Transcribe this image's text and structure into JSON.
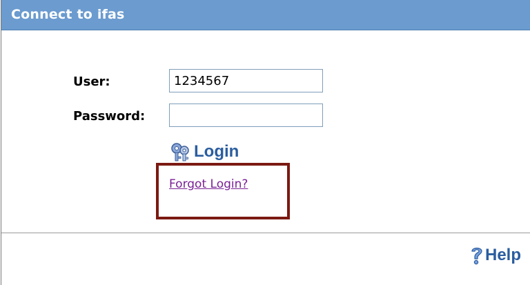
{
  "dialog": {
    "title": "Connect to ifas"
  },
  "form": {
    "user_label": "User:",
    "user_value": "1234567",
    "password_label": "Password:",
    "password_value": "",
    "login_label": "Login",
    "forgot_link": "Forgot Login?"
  },
  "footer": {
    "help_label": "Help"
  },
  "colors": {
    "title_bar": "#6b9bcf",
    "highlight_border": "#7b1a12",
    "link": "#7a1f96",
    "button_text": "#2a5d9f"
  },
  "icons": {
    "login": "keys-icon",
    "help": "question-mark-icon"
  }
}
